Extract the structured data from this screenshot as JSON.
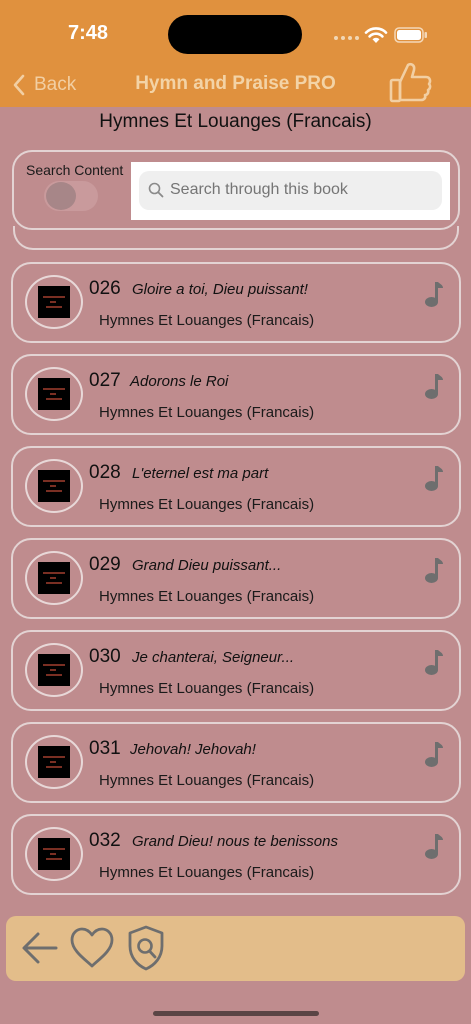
{
  "status_bar": {
    "time": "7:48"
  },
  "nav": {
    "back_label": "Back",
    "title": "Hymn and Praise PRO",
    "back_icon": "chevron-left-icon",
    "action_icon": "thumbs-up-icon"
  },
  "book_title": "Hymnes Et Louanges (Francais)",
  "search": {
    "toggle_label": "Search Content",
    "toggle_on": false,
    "placeholder": "Search through this book"
  },
  "hymns": [
    {
      "number": "026",
      "title": "Gloire a toi, Dieu puissant!",
      "book": "Hymnes Et Louanges (Francais)"
    },
    {
      "number": "027",
      "title": "Adorons le Roi",
      "book": "Hymnes Et Louanges (Francais)"
    },
    {
      "number": "028",
      "title": "L'eternel est ma part",
      "book": "Hymnes Et Louanges (Francais)"
    },
    {
      "number": "029",
      "title": "Grand Dieu puissant...",
      "book": "Hymnes Et Louanges (Francais)"
    },
    {
      "number": "030",
      "title": "Je chanterai, Seigneur...",
      "book": "Hymnes Et Louanges (Francais)"
    },
    {
      "number": "031",
      "title": "Jehovah! Jehovah!",
      "book": "Hymnes Et Louanges (Francais)"
    },
    {
      "number": "032",
      "title": "Grand Dieu! nous te benissons",
      "book": "Hymnes Et Louanges (Francais)"
    }
  ],
  "bottom_bar": {
    "icons": [
      "arrow-left-icon",
      "heart-icon",
      "shield-search-icon"
    ]
  },
  "colors": {
    "header": "#e0913e",
    "background": "#bf8c8e",
    "bottom_bar": "#e3bd8a"
  }
}
